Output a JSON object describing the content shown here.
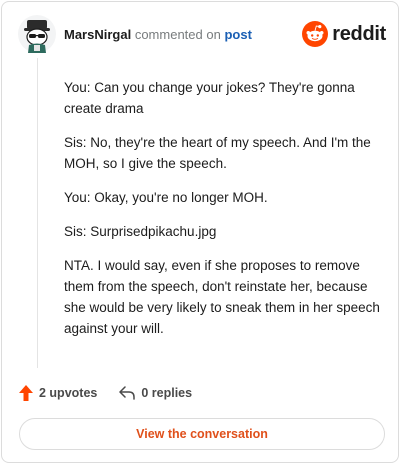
{
  "header": {
    "author": "MarsNirgal",
    "action": "commented on",
    "post_link": "post",
    "logo_text": "reddit"
  },
  "comment": {
    "paragraphs": [
      "You: Can you change your jokes? They're gonna create drama",
      "Sis: No, they're the heart of my speech. And I'm the MOH, so I give the speech.",
      "You: Okay, you're no longer MOH.",
      "Sis: Surprisedpikachu.jpg",
      "NTA. I would say, even if she proposes to remove them from the speech, don't reinstate her, because she would be very likely to sneak them in her speech against your will."
    ]
  },
  "footer": {
    "upvotes": "2 upvotes",
    "replies": "0 replies"
  },
  "view_button": "View the conversation",
  "colors": {
    "upvote": "#ff4500",
    "reddit_orange": "#ff4500",
    "link_blue": "#1a5fb4",
    "button_text": "#e0501b"
  }
}
